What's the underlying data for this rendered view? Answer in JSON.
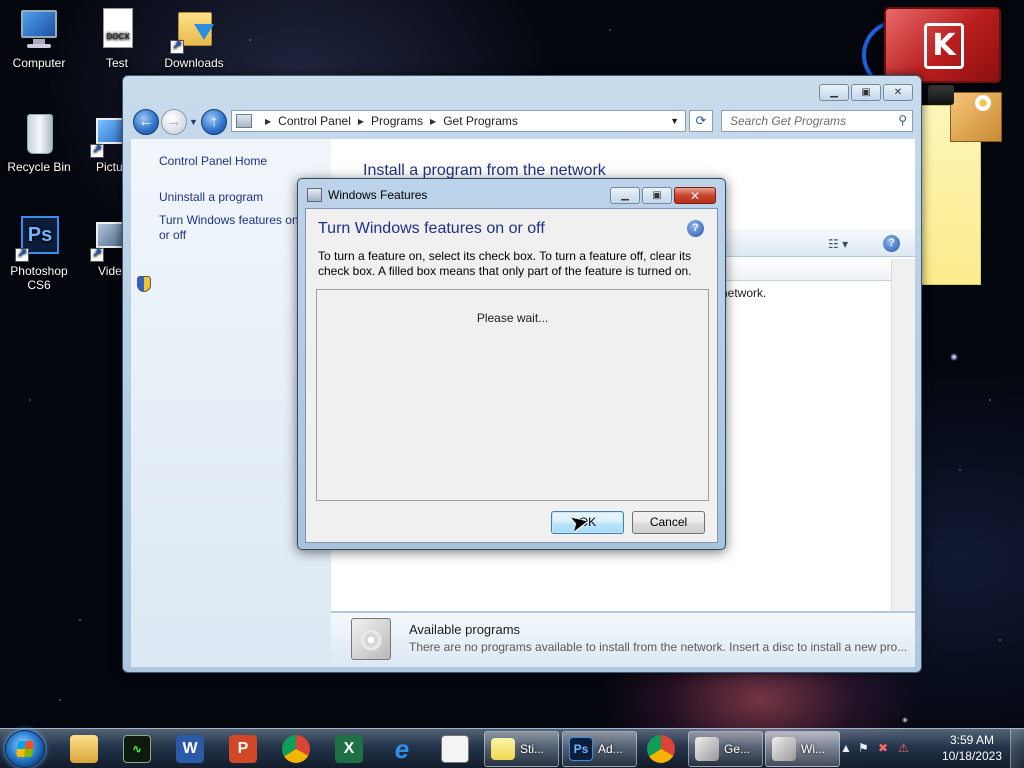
{
  "desktop": {
    "icons": [
      {
        "label": "Computer"
      },
      {
        "label": "Test"
      },
      {
        "label": "Downloads"
      },
      {
        "label": "Recycle Bin"
      },
      {
        "label": "Pictu"
      },
      {
        "label": "Photoshop CS6"
      },
      {
        "label": "Vide"
      }
    ],
    "docx_badge": "DOCX",
    "ps_badge": "Ps"
  },
  "explorer": {
    "breadcrumb": [
      "Control Panel",
      "Programs",
      "Get Programs"
    ],
    "search_placeholder": "Search Get Programs",
    "sidebar": {
      "home": "Control Panel Home",
      "uninstall": "Uninstall a program",
      "features": "Turn Windows features on or off"
    },
    "heading": "Install a program from the network",
    "row_fragment": "network.",
    "details": {
      "title": "Available programs",
      "text": "There are no programs available to install from the network.  Insert a disc to install a new pro..."
    }
  },
  "dialog": {
    "title": "Windows Features",
    "heading": "Turn Windows features on or off",
    "description": "To turn a feature on, select its check box. To turn a feature off, clear its check box. A filled box means that only part of the feature is turned on.",
    "status": "Please wait...",
    "ok_label": "OK",
    "cancel_label": "Cancel"
  },
  "taskbar": {
    "sticky_label": "Sti...",
    "ps_label": "Ad...",
    "ps_glyph": "Ps",
    "getprog_label": "Ge...",
    "winfeat_label": "Wi...",
    "word_glyph": "W",
    "ppt_glyph": "P",
    "excel_glyph": "X",
    "ie_glyph": "e"
  },
  "clock": {
    "time": "3:59 AM",
    "date": "10/18/2023"
  },
  "colors": {
    "link_blue": "#1e3287",
    "accent_blue": "#2a6fc8",
    "kaspersky_red": "#b91d1d"
  }
}
